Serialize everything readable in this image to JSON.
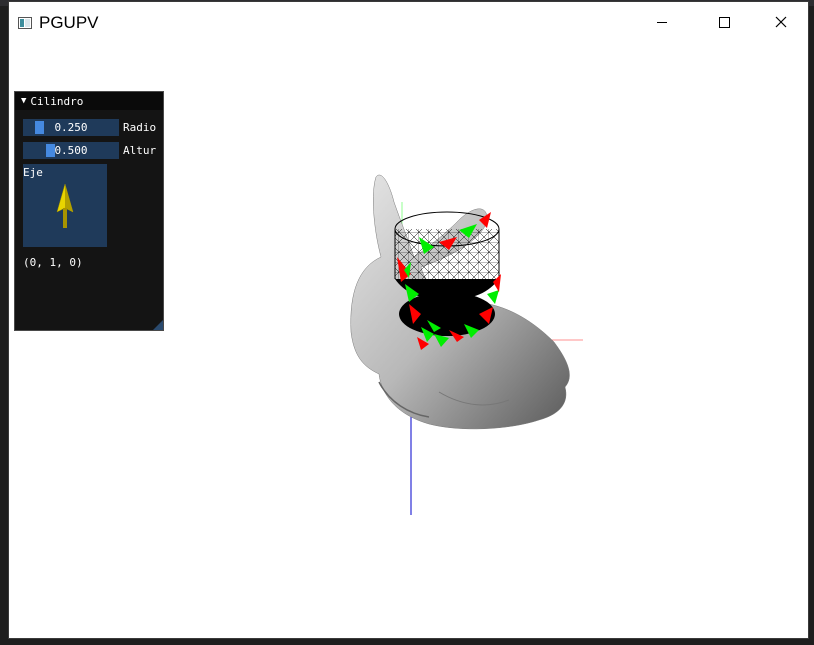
{
  "window": {
    "title": "PGUPV",
    "controls": [
      "minimize",
      "maximize",
      "close"
    ]
  },
  "panel": {
    "title": "Cilindro",
    "collapse_icon": "triangle-down-icon",
    "sliders": [
      {
        "value": "0.250",
        "label": "Radio",
        "fraction": 0.25
      },
      {
        "value": "0.500",
        "label": "Altur",
        "fraction": 0.5
      }
    ],
    "gizmo_label": "Eje",
    "axis_value": "(0, 1, 0)"
  },
  "viewport": {
    "scene": "bunny mesh with wireframe cylinder intersection",
    "axis_colors": {
      "x": "#ff8080",
      "y": "#80ff80",
      "z": "#0000ff"
    }
  }
}
